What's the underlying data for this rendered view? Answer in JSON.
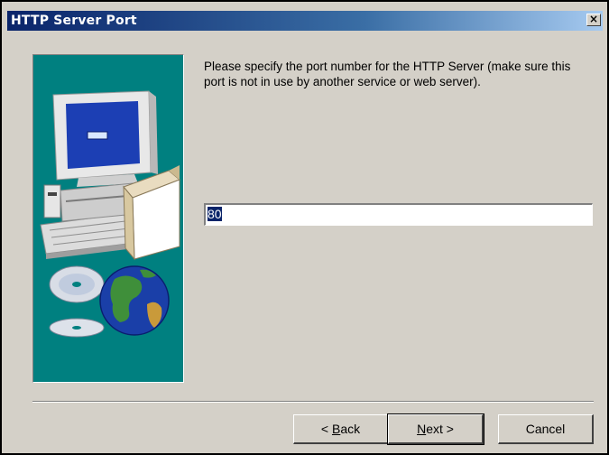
{
  "window": {
    "title": "HTTP Server Port",
    "close_glyph": "×"
  },
  "content": {
    "instruction": "Please specify the port number for the HTTP Server (make sure this port is not in use by another service or web server).",
    "port_value": "80",
    "illustration_icon": "computer-box-globe-cd-illustration"
  },
  "buttons": {
    "back_prefix": "< ",
    "back_mnemonic": "B",
    "back_rest": "ack",
    "next_mnemonic": "N",
    "next_rest": "ext >",
    "cancel": "Cancel"
  },
  "colors": {
    "title_bar_start": "#0a246a",
    "title_bar_end": "#a6caf0",
    "dialog_background": "#d4d0c8",
    "side_panel": "#008080",
    "selection": "#0a246a"
  }
}
